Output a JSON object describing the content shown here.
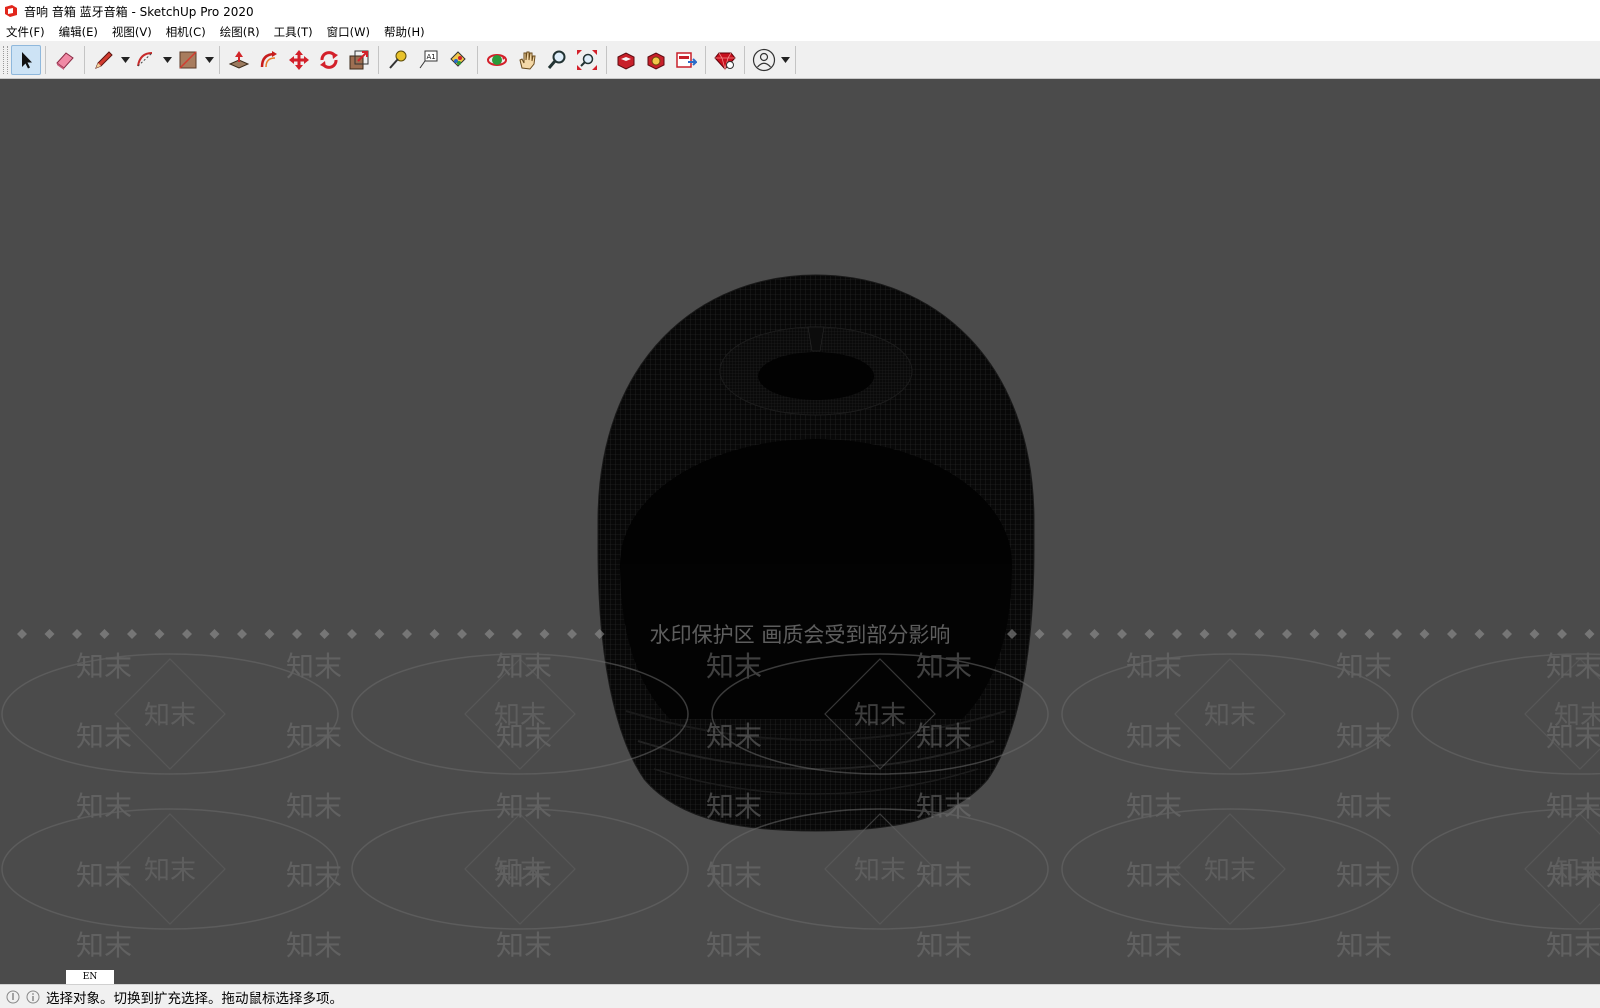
{
  "window": {
    "title": "音响 音箱 蓝牙音箱 - SketchUp Pro 2020",
    "app_icon": "sketchup-logo-icon"
  },
  "menu": [
    {
      "label": "文件(F)"
    },
    {
      "label": "编辑(E)"
    },
    {
      "label": "视图(V)"
    },
    {
      "label": "相机(C)"
    },
    {
      "label": "绘图(R)"
    },
    {
      "label": "工具(T)"
    },
    {
      "label": "窗口(W)"
    },
    {
      "label": "帮助(H)"
    }
  ],
  "toolbar": {
    "tools": [
      {
        "name": "select-tool",
        "icon": "select-arrow-icon",
        "active": true
      },
      {
        "name": "eraser-tool",
        "icon": "eraser-icon"
      },
      {
        "name": "line-tool",
        "icon": "pencil-icon",
        "dropdown": true
      },
      {
        "name": "arc-tool",
        "icon": "arc-icon",
        "dropdown": true
      },
      {
        "name": "rectangle-tool",
        "icon": "rectangle-icon",
        "dropdown": true
      },
      {
        "name": "push-pull-tool",
        "icon": "push-pull-icon"
      },
      {
        "name": "offset-tool",
        "icon": "offset-icon"
      },
      {
        "name": "move-tool",
        "icon": "move-icon"
      },
      {
        "name": "rotate-tool",
        "icon": "rotate-icon"
      },
      {
        "name": "scale-tool",
        "icon": "scale-icon"
      },
      {
        "name": "tape-measure-tool",
        "icon": "tape-measure-icon"
      },
      {
        "name": "text-tool",
        "icon": "text-icon"
      },
      {
        "name": "paint-bucket-tool",
        "icon": "paint-bucket-icon"
      },
      {
        "name": "orbit-tool",
        "icon": "orbit-icon"
      },
      {
        "name": "pan-tool",
        "icon": "pan-hand-icon"
      },
      {
        "name": "zoom-tool",
        "icon": "zoom-icon"
      },
      {
        "name": "zoom-extents-tool",
        "icon": "zoom-extents-icon"
      },
      {
        "name": "3d-warehouse",
        "icon": "warehouse-icon"
      },
      {
        "name": "extension-warehouse",
        "icon": "extension-warehouse-icon"
      },
      {
        "name": "layout-send",
        "icon": "layout-icon"
      },
      {
        "name": "extension-manager",
        "icon": "ruby-gem-icon"
      },
      {
        "name": "account",
        "icon": "user-account-icon",
        "dropdown": true
      }
    ]
  },
  "watermark": {
    "banner_text": "水印保护区   画质会受到部分影响",
    "tile_text": "知末"
  },
  "statusbar": {
    "hint": "选择对象。切换到扩充选择。拖动鼠标选择多项。",
    "language": "EN"
  },
  "colors": {
    "viewport_bg": "#4b4b4b",
    "model": "#050505"
  }
}
